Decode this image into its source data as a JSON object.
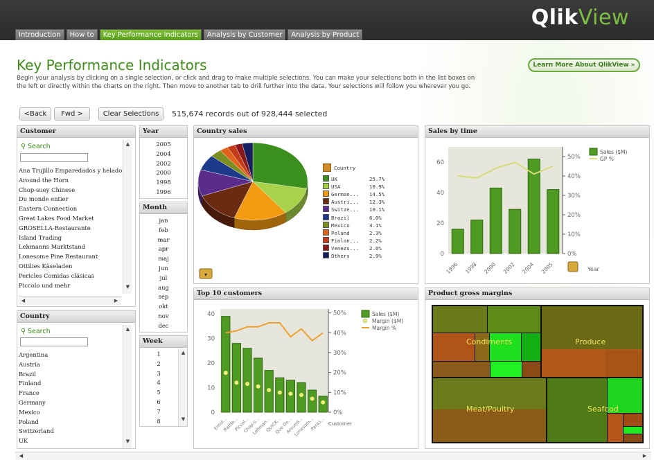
{
  "app": {
    "brand_main": "Qlik",
    "brand_accent": "View"
  },
  "tabs": [
    {
      "label": "Introduction",
      "active": false
    },
    {
      "label": "How to",
      "active": false
    },
    {
      "label": "Key Performance Indicators",
      "active": true
    },
    {
      "label": "Analysis by Customer",
      "active": false
    },
    {
      "label": "Analysis by Product",
      "active": false
    }
  ],
  "page": {
    "title": "Key Performance Indicators",
    "description_1": "Begin your analysis by clicking on a single selection, or click and drag to make multiple selections. You can make your selections both in the list boxes on",
    "description_2": "the left or directly within the charts on the right. Then move to another tab to drill further into the data. Your selections will follow you wherever you go.",
    "learn_more": "Learn More About QlikView »"
  },
  "toolbar": {
    "back": "<Back",
    "forward": "Fwd >",
    "clear": "Clear Selections",
    "selection_info": "515,674 records out of 928,444 selected"
  },
  "customer": {
    "title": "Customer",
    "search": "Search",
    "items": [
      "Ana Trujillo Emparedados y helados",
      "Around the Horn",
      "Chop-suey Chinese",
      "Du monde entier",
      "Eastern Connection",
      "Great Lakes Food Market",
      "GROSELLA-Restaurante",
      "Island Trading",
      "Lehmanns Marktstand",
      "Lonesome Pine Restaurant",
      "Ottilies Käseladen",
      "Pericles Comidas clásicas",
      "Piccolo und mehr"
    ]
  },
  "country_list": {
    "title": "Country",
    "search": "Search",
    "items": [
      "Argentina",
      "Austria",
      "Brazil",
      "Finland",
      "France",
      "Germany",
      "Mexico",
      "Poland",
      "Switzerland",
      "UK"
    ]
  },
  "year": {
    "title": "Year",
    "items": [
      "2005",
      "2004",
      "2002",
      "2000",
      "1998",
      "1996"
    ]
  },
  "month": {
    "title": "Month",
    "items": [
      "jan",
      "feb",
      "mar",
      "apr",
      "maj",
      "jun",
      "jul",
      "aug",
      "sep",
      "okt",
      "nov",
      "dec"
    ]
  },
  "week": {
    "title": "Week",
    "items": [
      "1",
      "2",
      "3",
      "4",
      "5",
      "6",
      "7",
      "8"
    ]
  },
  "country_sales": {
    "title": "Country sales",
    "legend_title": "Country",
    "slices": [
      {
        "label": "UK",
        "pct": "25.7%",
        "value": 25.7,
        "color": "#3b8f1c"
      },
      {
        "label": "USA",
        "pct": "10.9%",
        "value": 10.9,
        "color": "#a8d24a"
      },
      {
        "label": "German...",
        "pct": "14.5%",
        "value": 14.5,
        "color": "#f39c12"
      },
      {
        "label": "Austri...",
        "pct": "12.3%",
        "value": 12.3,
        "color": "#6b2a12"
      },
      {
        "label": "Switze...",
        "pct": "10.1%",
        "value": 10.1,
        "color": "#5a2d8c"
      },
      {
        "label": "Brazil",
        "pct": "6.0%",
        "value": 6.0,
        "color": "#1e3a8a"
      },
      {
        "label": "Mexico",
        "pct": "3.1%",
        "value": 3.1,
        "color": "#7a8f1f"
      },
      {
        "label": "Poland",
        "pct": "2.3%",
        "value": 2.3,
        "color": "#e0631b"
      },
      {
        "label": "Finlan...",
        "pct": "2.2%",
        "value": 2.2,
        "color": "#c23b1a"
      },
      {
        "label": "Venezu...",
        "pct": "2.0%",
        "value": 2.0,
        "color": "#8a1a1a"
      },
      {
        "label": "Others",
        "pct": "2.9%",
        "value": 2.9,
        "color": "#16205e"
      }
    ]
  },
  "sales_by_time": {
    "title": "Sales by time",
    "legend": [
      {
        "label": "Sales ($M)",
        "color": "#4e9a22"
      },
      {
        "label": "GP %",
        "color": "#d6dc7a"
      }
    ],
    "y_ticks": [
      "0",
      "20",
      "40",
      "60"
    ],
    "y2_ticks": [
      "0%",
      "10%",
      "20%",
      "30%",
      "40%",
      "50%"
    ],
    "x_title": "Year",
    "chart_data": {
      "type": "bar",
      "categories": [
        "1996",
        "1998",
        "2000",
        "2002",
        "2004",
        "2005"
      ],
      "series": [
        {
          "name": "Sales ($M)",
          "values": [
            16,
            22,
            43,
            29,
            62,
            42
          ]
        },
        {
          "name": "GP %",
          "values": [
            40,
            39,
            44,
            47,
            41,
            45
          ]
        }
      ],
      "ylim": [
        0,
        70
      ],
      "y2lim": [
        0,
        55
      ]
    }
  },
  "top10": {
    "title": "Top 10 customers",
    "legend": [
      {
        "label": "Sales ($M)",
        "color": "#4e9a22"
      },
      {
        "label": "Margin ($M)",
        "color": "#e8e870"
      },
      {
        "label": "Margin %",
        "color": "#f0a030"
      }
    ],
    "y_ticks": [
      "0",
      "10",
      "20",
      "30",
      "40"
    ],
    "y2_ticks": [
      "0%",
      "10%",
      "20%",
      "30%",
      "40%",
      "50%"
    ],
    "x_title": "Customer",
    "chart_data": {
      "type": "bar",
      "categories": [
        "Ernst...",
        "Rattle...",
        "Piccol...",
        "Chop-s...",
        "Lehman...",
        "QUICK...",
        "Que De...",
        "Around...",
        "Lonesom...",
        "Perici..."
      ],
      "series": [
        {
          "name": "Sales ($M)",
          "values": [
            39,
            28,
            26,
            22,
            17,
            14,
            13,
            12,
            9,
            6.5
          ]
        },
        {
          "name": "Margin ($M)",
          "values": [
            16,
            12,
            11.5,
            10.5,
            9,
            8,
            7.5,
            7,
            5.5,
            4
          ]
        },
        {
          "name": "Margin %",
          "values": [
            40,
            41,
            43,
            43,
            45,
            45,
            38,
            42,
            36,
            40
          ]
        }
      ],
      "ylim": [
        0,
        42
      ],
      "y2lim": [
        0,
        52
      ]
    }
  },
  "gross_margins": {
    "title": "Product gross margins",
    "categories": [
      "Condiments",
      "Produce",
      "Meat/Poultry",
      "Seafood"
    ]
  },
  "colors": {
    "accent": "#5aa019",
    "title_green": "#3f8c1a",
    "header_dark": "#2b2b2b"
  }
}
